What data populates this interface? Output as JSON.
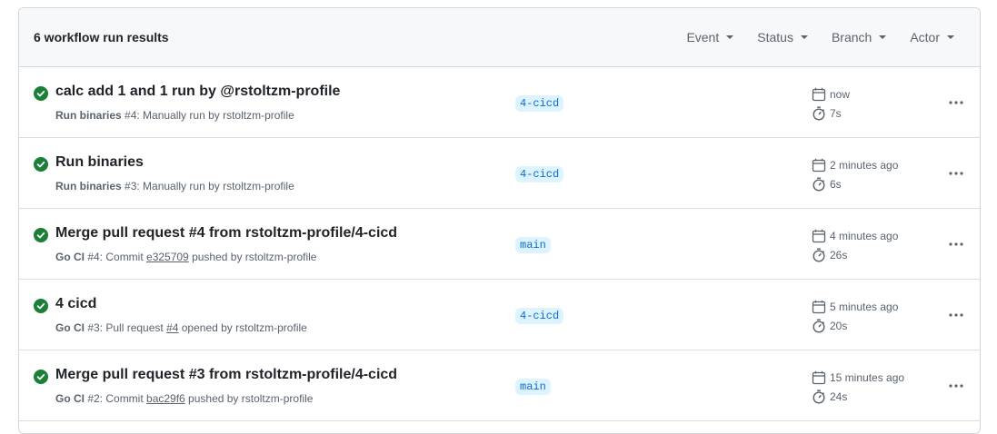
{
  "header": {
    "results_count": "6 workflow run results",
    "filters": [
      "Event",
      "Status",
      "Branch",
      "Actor"
    ]
  },
  "colors": {
    "success": "#1a7f37",
    "branch_bg": "#ddf4ff",
    "branch_text": "#0969da"
  },
  "icons": {
    "status": "check-circle-fill-icon",
    "date": "calendar-icon",
    "duration": "stopwatch-icon",
    "menu": "kebab-horizontal-icon"
  },
  "runs": [
    {
      "title": "calc add 1 and 1 run by @rstoltzm-profile",
      "workflow": "Run binaries",
      "meta_mid": " #4: Manually run by rstoltzm-profile",
      "link": "",
      "meta_end": "",
      "branch": "4-cicd",
      "time": "now",
      "duration": "7s"
    },
    {
      "title": "Run binaries",
      "workflow": "Run binaries",
      "meta_mid": " #3: Manually run by rstoltzm-profile",
      "link": "",
      "meta_end": "",
      "branch": "4-cicd",
      "time": "2 minutes ago",
      "duration": "6s"
    },
    {
      "title": "Merge pull request #4 from rstoltzm-profile/4-cicd",
      "workflow": "Go CI",
      "meta_mid": " #4: Commit ",
      "link": "e325709",
      "meta_end": " pushed by rstoltzm-profile",
      "branch": "main",
      "time": "4 minutes ago",
      "duration": "26s"
    },
    {
      "title": "4 cicd",
      "workflow": "Go CI",
      "meta_mid": " #3: Pull request ",
      "link": "#4",
      "meta_end": " opened by rstoltzm-profile",
      "branch": "4-cicd",
      "time": "5 minutes ago",
      "duration": "20s"
    },
    {
      "title": "Merge pull request #3 from rstoltzm-profile/4-cicd",
      "workflow": "Go CI",
      "meta_mid": " #2: Commit ",
      "link": "bac29f6",
      "meta_end": " pushed by rstoltzm-profile",
      "branch": "main",
      "time": "15 minutes ago",
      "duration": "24s"
    }
  ]
}
